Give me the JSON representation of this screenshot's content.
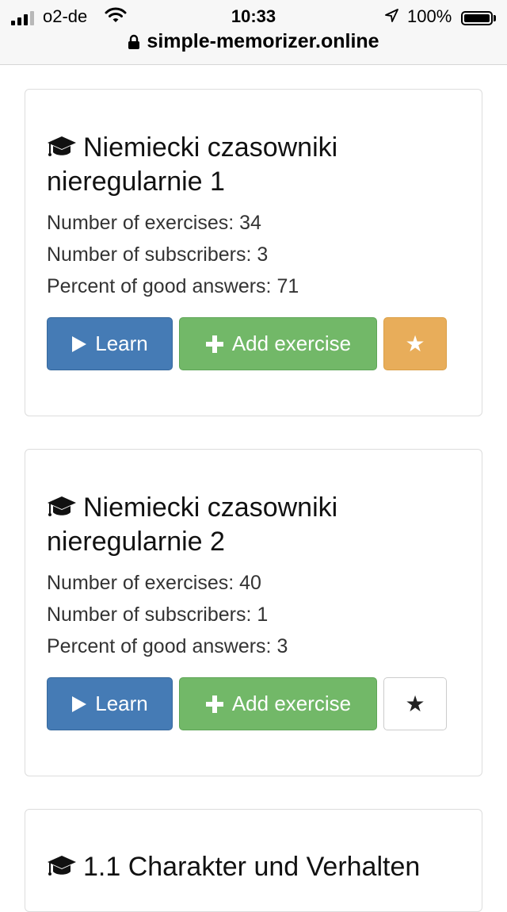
{
  "status_bar": {
    "carrier": "o2-de",
    "time": "10:33",
    "battery": "100%",
    "url": "simple-memorizer.online"
  },
  "courses": [
    {
      "title": "Niemiecki czasowniki nieregularnie 1",
      "exercises": "Number of exercises: 34",
      "subscribers": "Number of subscribers: 3",
      "percent": "Percent of good answers: 71",
      "learn_label": "Learn",
      "add_label": "Add exercise",
      "star_label": "★",
      "starred": true
    },
    {
      "title": "Niemiecki czasowniki nieregularnie 2",
      "exercises": "Number of exercises: 40",
      "subscribers": "Number of subscribers: 1",
      "percent": "Percent of good answers: 3",
      "learn_label": "Learn",
      "add_label": "Add exercise",
      "star_label": "★",
      "starred": false
    },
    {
      "title": "1.1 Charakter und Verhalten"
    }
  ],
  "colors": {
    "learn": "#457bb5",
    "add": "#72b868",
    "star_active": "#e8ad5a"
  },
  "icons": {
    "course": "graduation-cap-icon",
    "learn": "play-icon",
    "add": "plus-icon",
    "favorite": "star-icon"
  }
}
